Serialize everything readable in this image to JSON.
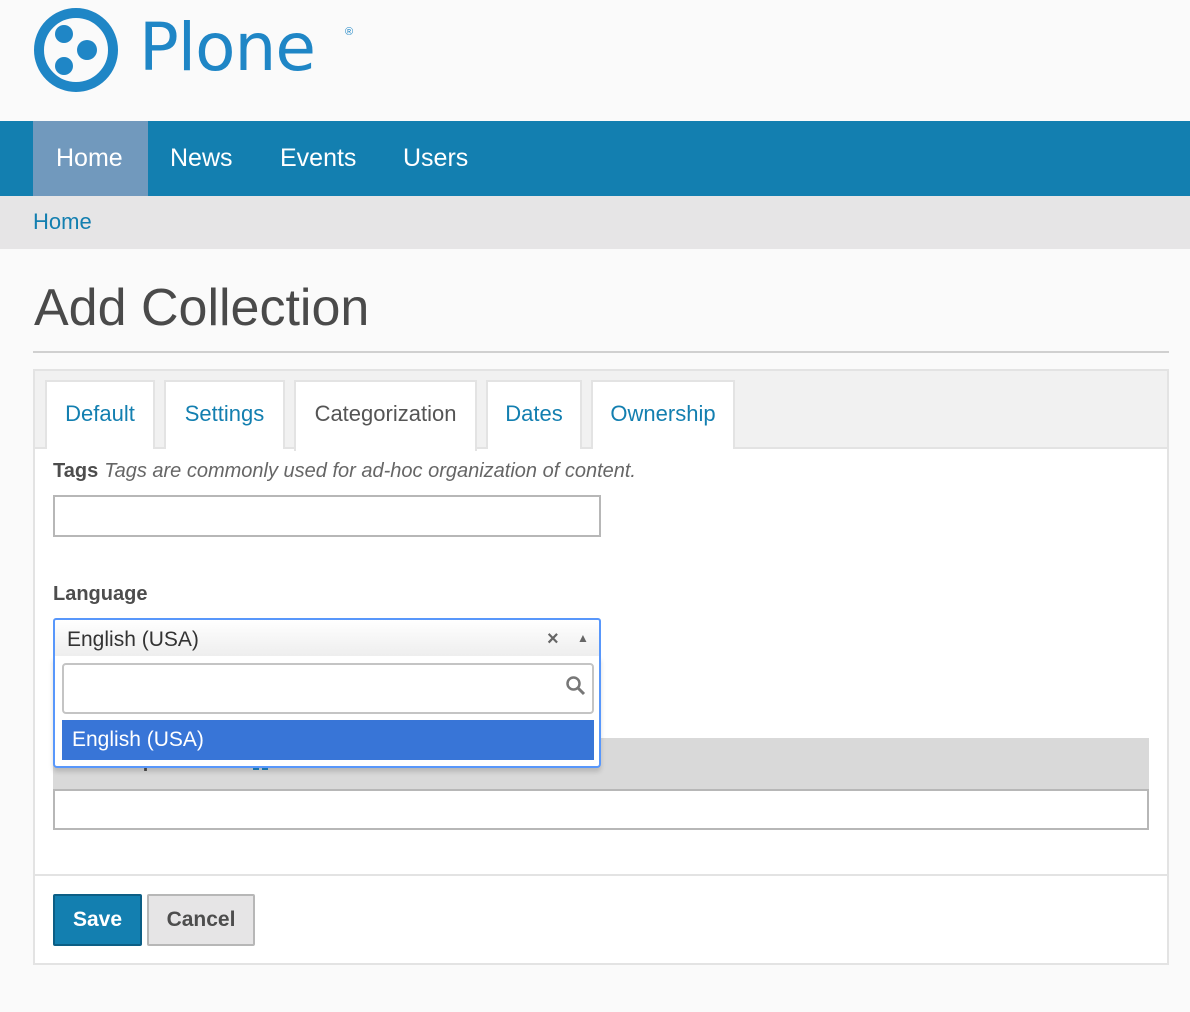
{
  "logo": {
    "text": "Plone",
    "mark": "®",
    "icon": "plone-logo-icon"
  },
  "nav": {
    "items": [
      "Home",
      "News",
      "Events",
      "Users"
    ],
    "active": "Home"
  },
  "breadcrumb": {
    "home": "Home"
  },
  "page": {
    "title": "Add Collection"
  },
  "tabs": {
    "items": [
      "Default",
      "Settings",
      "Categorization",
      "Dates",
      "Ownership"
    ],
    "active": "Categorization"
  },
  "fields": {
    "tags": {
      "label": "Tags",
      "help": "Tags are commonly used for ad-hoc organization of content.",
      "value": ""
    },
    "language": {
      "label": "Language",
      "value": "English (USA)",
      "clear_icon": "×",
      "arrow_icon": "▲"
    },
    "dropdown": {
      "search_value": "",
      "options": [
        "English (USA)"
      ],
      "highlighted": "English (USA)"
    },
    "path": {
      "label": "Current path:",
      "value": ""
    }
  },
  "buttons": {
    "save": "Save",
    "cancel": "Cancel"
  },
  "colors": {
    "brand": "#137fb0",
    "nav_active": "#7199bd",
    "option_highlight": "#3875d7",
    "select_focus": "#5897fb"
  }
}
